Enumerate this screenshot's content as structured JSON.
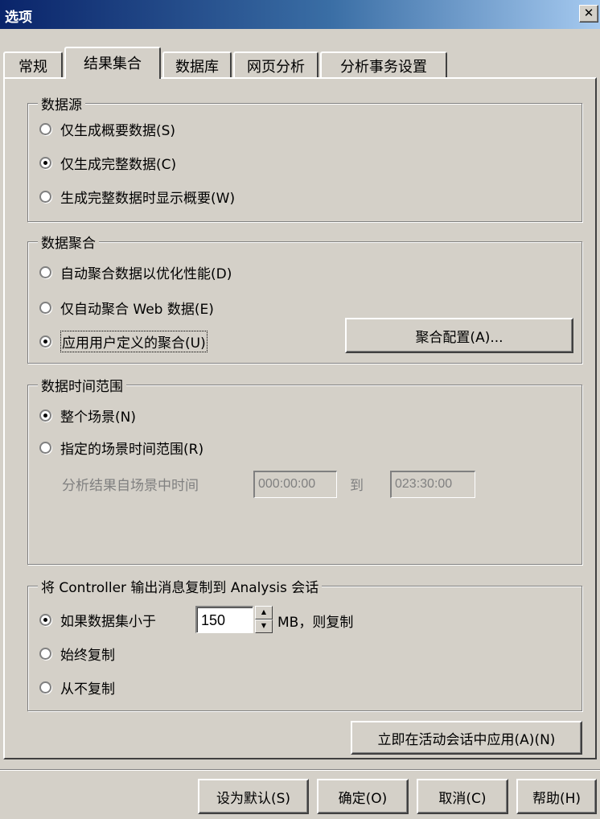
{
  "window": {
    "title": "选项",
    "close_symbol": "✕"
  },
  "tabs": [
    {
      "label": "常规"
    },
    {
      "label": "结果集合"
    },
    {
      "label": "数据库"
    },
    {
      "label": "网页分析"
    },
    {
      "label": "分析事务设置"
    }
  ],
  "active_tab_index": 1,
  "data_source": {
    "legend": "数据源",
    "options": [
      {
        "label": "仅生成概要数据(S)",
        "checked": false
      },
      {
        "label": "仅生成完整数据(C)",
        "checked": true
      },
      {
        "label": "生成完整数据时显示概要(W)",
        "checked": false
      }
    ]
  },
  "aggregation": {
    "legend": "数据聚合",
    "options": [
      {
        "label": "自动聚合数据以优化性能(D)",
        "checked": false
      },
      {
        "label": "仅自动聚合 Web 数据(E)",
        "checked": false
      },
      {
        "label": "应用用户定义的聚合(U)",
        "checked": true
      }
    ],
    "config_button": "聚合配置(A)..."
  },
  "time_range": {
    "legend": "数据时间范围",
    "options": [
      {
        "label": "整个场景(N)",
        "checked": true
      },
      {
        "label": "指定的场景时间范围(R)",
        "checked": false
      }
    ],
    "range_label": "分析结果自场景中时间",
    "from_value": "000:00:00",
    "to_label": "到",
    "to_value": "023:30:00"
  },
  "copy_messages": {
    "legend": "将 Controller 输出消息复制到 Analysis 会话",
    "options": [
      {
        "label": "如果数据集小于",
        "checked": true
      },
      {
        "label": "始终复制",
        "checked": false
      },
      {
        "label": "从不复制",
        "checked": false
      }
    ],
    "size_value": "150",
    "size_suffix": "MB，则复制"
  },
  "apply_now_button": "立即在活动会话中应用(A)(N)",
  "footer": {
    "set_default": "设为默认(S)",
    "ok": "确定(O)",
    "cancel": "取消(C)",
    "help": "帮助(H)"
  },
  "colors": {
    "dialog_bg": "#d4d0c8",
    "title_start": "#0a246a",
    "title_end": "#a6caf0"
  }
}
